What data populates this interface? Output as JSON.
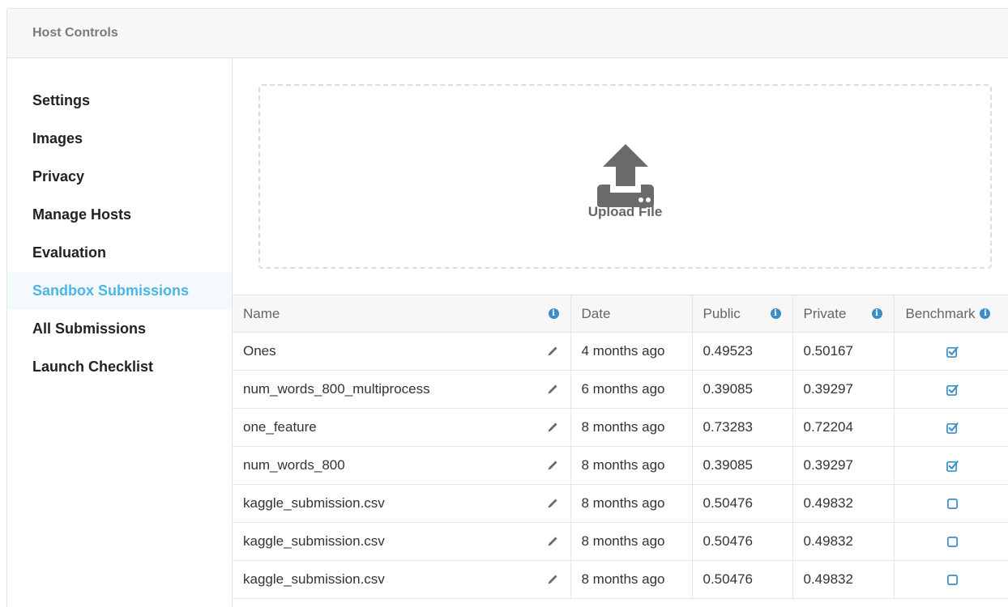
{
  "panel": {
    "title": "Host Controls"
  },
  "sidebar": {
    "items": [
      {
        "label": "Settings",
        "active": false
      },
      {
        "label": "Images",
        "active": false
      },
      {
        "label": "Privacy",
        "active": false
      },
      {
        "label": "Manage Hosts",
        "active": false
      },
      {
        "label": "Evaluation",
        "active": false
      },
      {
        "label": "Sandbox Submissions",
        "active": true
      },
      {
        "label": "All Submissions",
        "active": false
      },
      {
        "label": "Launch Checklist",
        "active": false
      }
    ]
  },
  "upload": {
    "label": "Upload File",
    "icon": "upload-icon"
  },
  "table": {
    "columns": {
      "name": "Name",
      "date": "Date",
      "public": "Public",
      "private": "Private",
      "benchmark": "Benchmark"
    },
    "rows": [
      {
        "name": "Ones",
        "date": "4 months ago",
        "public": "0.49523",
        "private": "0.50167",
        "benchmark": true
      },
      {
        "name": "num_words_800_multiprocess",
        "date": "6 months ago",
        "public": "0.39085",
        "private": "0.39297",
        "benchmark": true
      },
      {
        "name": "one_feature",
        "date": "8 months ago",
        "public": "0.73283",
        "private": "0.72204",
        "benchmark": true
      },
      {
        "name": "num_words_800",
        "date": "8 months ago",
        "public": "0.39085",
        "private": "0.39297",
        "benchmark": true
      },
      {
        "name": "kaggle_submission.csv",
        "date": "8 months ago",
        "public": "0.50476",
        "private": "0.49832",
        "benchmark": false
      },
      {
        "name": "kaggle_submission.csv",
        "date": "8 months ago",
        "public": "0.50476",
        "private": "0.49832",
        "benchmark": false
      },
      {
        "name": "kaggle_submission.csv",
        "date": "8 months ago",
        "public": "0.50476",
        "private": "0.49832",
        "benchmark": false
      }
    ]
  },
  "colors": {
    "accent": "#4db5e6",
    "icon": "#6b6b6b",
    "info": "#3a8dc6",
    "check": "#3a8dc6"
  }
}
